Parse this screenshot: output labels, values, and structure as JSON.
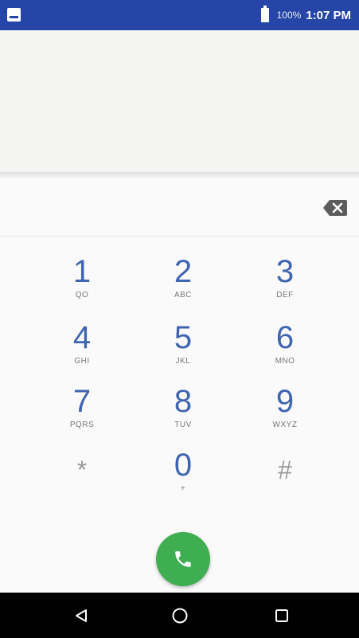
{
  "status_bar": {
    "battery_percent": "100%",
    "time": "1:07 PM",
    "icons": [
      "notification-icon",
      "battery-icon"
    ]
  },
  "digits": {
    "value": "",
    "backspace_icon": "backspace-icon"
  },
  "keypad": [
    {
      "digit": "1",
      "letters": "QO"
    },
    {
      "digit": "2",
      "letters": "ABC"
    },
    {
      "digit": "3",
      "letters": "DEF"
    },
    {
      "digit": "4",
      "letters": "GHI"
    },
    {
      "digit": "5",
      "letters": "JKL"
    },
    {
      "digit": "6",
      "letters": "MNO"
    },
    {
      "digit": "7",
      "letters": "PQRS"
    },
    {
      "digit": "8",
      "letters": "TUV"
    },
    {
      "digit": "9",
      "letters": "WXYZ"
    },
    {
      "digit": "*",
      "letters": ""
    },
    {
      "digit": "0",
      "letters": "+"
    },
    {
      "digit": "#",
      "letters": ""
    }
  ],
  "call_button": {
    "icon": "phone-icon",
    "color": "#3fad52"
  },
  "nav_bar": {
    "icons": [
      "back-icon",
      "home-icon",
      "recents-icon"
    ]
  },
  "colors": {
    "status_bar": "#2546a6",
    "key_digit": "#3f64b0",
    "nav_bar": "#000000"
  }
}
